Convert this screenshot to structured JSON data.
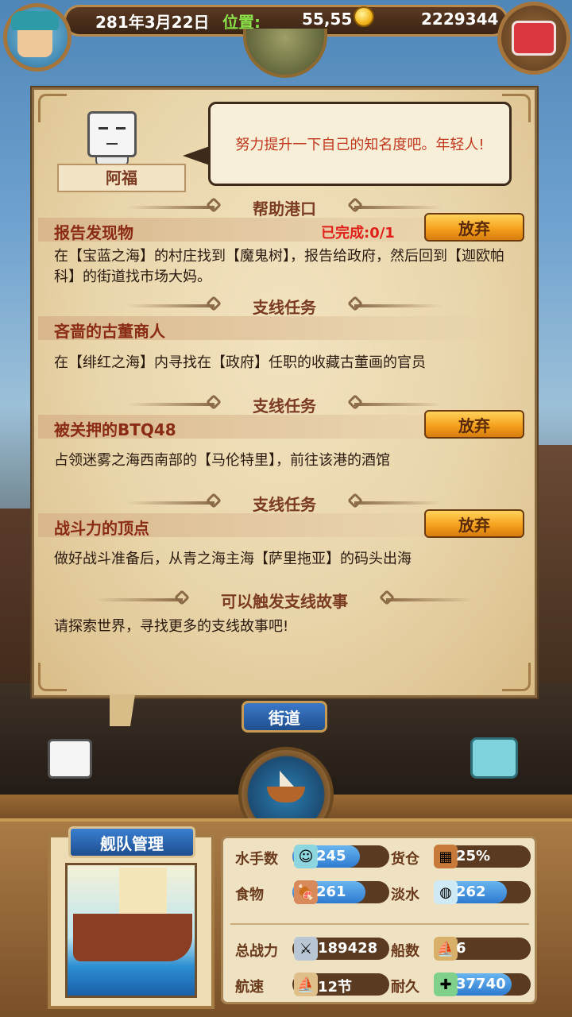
{
  "header": {
    "date": "281年3月22日",
    "position_label": "位置:",
    "position_value": "55,55",
    "gold": "2229344"
  },
  "icons": [
    "avatar-icon",
    "globe-icon",
    "coin-icon",
    "treasure-chest-icon",
    "ship-wheel-icon"
  ],
  "dialog": {
    "npc_name": "阿福",
    "speech": "努力提升一下自己的知名度吧。年轻人!"
  },
  "sections": [
    {
      "title": "帮助港口"
    },
    {
      "title": "支线任务"
    },
    {
      "title": "支线任务"
    },
    {
      "title": "支线任务"
    },
    {
      "title": "可以触发支线故事"
    }
  ],
  "quests": [
    {
      "title": "报告发现物",
      "progress": "已完成:0/1",
      "desc": "在【宝蓝之海】的村庄找到【魔鬼树】，报告给政府，然后回到【迦欧帕科】的街道找市场大妈。",
      "action": "放弃"
    },
    {
      "title": "吝啬的古董商人",
      "desc": "在【绯红之海】内寻找在【政府】任职的收藏古董画的官员"
    },
    {
      "title": "被关押的BTQ48",
      "desc": "占领迷雾之海西南部的【马伦特里】，前往该港的酒馆",
      "action": "放弃"
    },
    {
      "title": "战斗力的顶点",
      "desc": "做好战斗准备后，从青之海主海【萨里拖亚】的码头出海",
      "action": "放弃"
    }
  ],
  "story_hint": "请探索世界，寻找更多的支线故事吧!",
  "location_button": "街道",
  "fleet": {
    "button": "舰队管理",
    "stats": [
      {
        "label": "水手数",
        "value": "245",
        "fill": 0.7
      },
      {
        "label": "货仓",
        "value": "25%",
        "fill": 0.25
      },
      {
        "label": "食物",
        "value": "261",
        "fill": 0.75
      },
      {
        "label": "淡水",
        "value": "262",
        "fill": 0.75
      },
      {
        "label": "总战力",
        "value": "189428",
        "fill": 0
      },
      {
        "label": "船数",
        "value": "6",
        "fill": 0
      },
      {
        "label": "航速",
        "value": "12节",
        "fill": 0
      },
      {
        "label": "耐久",
        "value": "37740",
        "fill": 0.8
      }
    ]
  }
}
